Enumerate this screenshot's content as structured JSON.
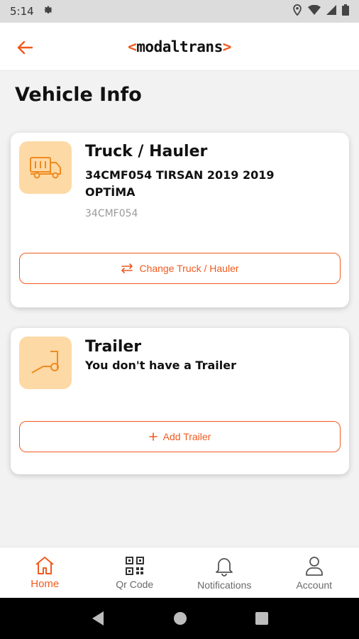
{
  "status_bar": {
    "time": "5:14"
  },
  "app_bar": {
    "logo_left": "<",
    "logo_text": "modaltrans",
    "logo_right": ">"
  },
  "page_title": "Vehicle Info",
  "truck_card": {
    "title": "Truck / Hauler",
    "description": "34CMF054 TIRSAN 2019 2019 OPTİMA",
    "plate": "34CMF054",
    "button_label": "Change Truck / Hauler"
  },
  "trailer_card": {
    "title": "Trailer",
    "description": "You don't have a Trailer",
    "button_label": "Add Trailer"
  },
  "bottom_nav": {
    "items": [
      {
        "label": "Home",
        "icon": "home-icon",
        "active": true
      },
      {
        "label": "Qr Code",
        "icon": "qr-code-icon"
      },
      {
        "label": "Notifications",
        "icon": "bell-icon"
      },
      {
        "label": "Account",
        "icon": "user-icon"
      }
    ]
  },
  "colors": {
    "accent": "#f05a1e",
    "icon_bg": "#fdd9a6",
    "status_bar": "#dcdcdc"
  }
}
